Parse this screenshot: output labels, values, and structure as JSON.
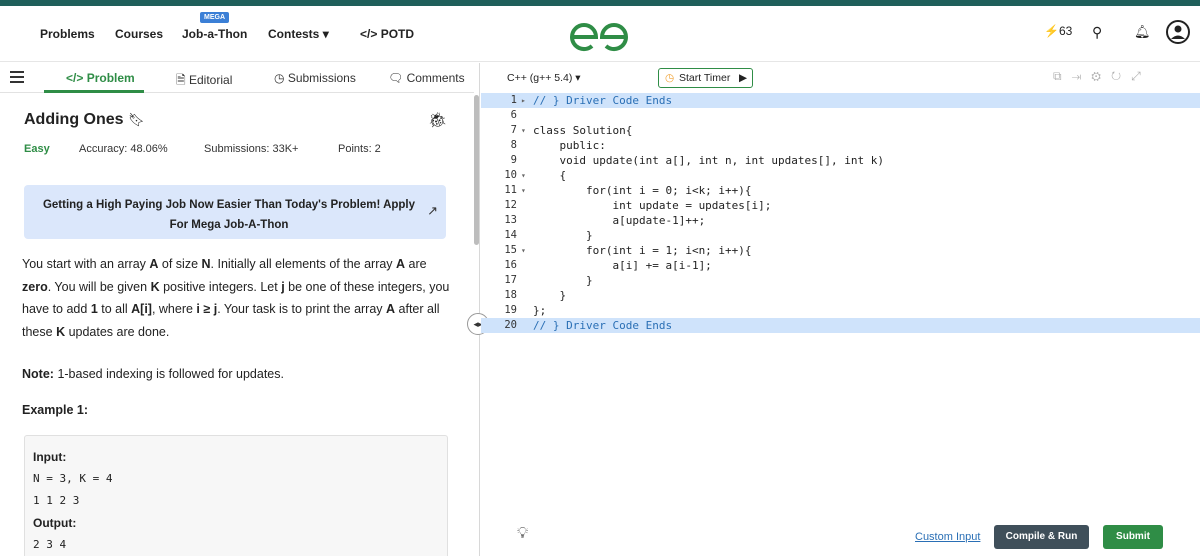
{
  "nav": {
    "items": [
      "Problems",
      "Courses",
      "Job-a-Thon",
      "Contests",
      "POTD"
    ],
    "mega_badge": "MEGA",
    "contests_caret": "▾",
    "potd_prefix": "</>",
    "streak": "63",
    "logo_text": "GfG"
  },
  "tabs": {
    "problem": "Problem",
    "editorial": "Editorial",
    "submissions": "Submissions",
    "comments": "Comments"
  },
  "problem": {
    "title": "Adding Ones",
    "difficulty": "Easy",
    "accuracy": "Accuracy: 48.06%",
    "submissions": "Submissions: 33K+",
    "points": "Points: 2",
    "banner": "Getting a High Paying Job Now Easier Than Today's Problem! Apply For Mega Job-A-Thon",
    "note": "1-based indexing is followed for updates.",
    "note_label": "Note:",
    "example_title": "Example 1:",
    "example": {
      "input_label": "Input:",
      "input_line1": "N = 3, K = 4",
      "input_line2": "1 1 2 3",
      "output_label": "Output:",
      "output_line1": "2 3 4"
    }
  },
  "editor": {
    "language": "C++ (g++ 5.4)",
    "timer": "Start Timer",
    "lines": [
      {
        "n": "1",
        "t": "// } Driver Code Ends",
        "hl": true
      },
      {
        "n": "6",
        "t": ""
      },
      {
        "n": "7",
        "t": "class Solution{"
      },
      {
        "n": "8",
        "t": "    public:"
      },
      {
        "n": "9",
        "t": "    void update(int a[], int n, int updates[], int k)"
      },
      {
        "n": "10",
        "t": "    {"
      },
      {
        "n": "11",
        "t": "        for(int i = 0; i<k; i++){"
      },
      {
        "n": "12",
        "t": "            int update = updates[i];"
      },
      {
        "n": "13",
        "t": "            a[update-1]++;"
      },
      {
        "n": "14",
        "t": "        }"
      },
      {
        "n": "15",
        "t": "        for(int i = 1; i<n; i++){"
      },
      {
        "n": "16",
        "t": "            a[i] += a[i-1];"
      },
      {
        "n": "17",
        "t": "        }"
      },
      {
        "n": "18",
        "t": "    }"
      },
      {
        "n": "19",
        "t": "};"
      },
      {
        "n": "20",
        "t": "// } Driver Code Ends",
        "hl": true
      }
    ],
    "custom_input": "Custom Input",
    "compile_run": "Compile & Run",
    "submit": "Submit"
  },
  "colors": {
    "brand_green": "#2f8d46",
    "banner_bg": "#dbe7fb",
    "highlight": "#cfe3fb"
  }
}
